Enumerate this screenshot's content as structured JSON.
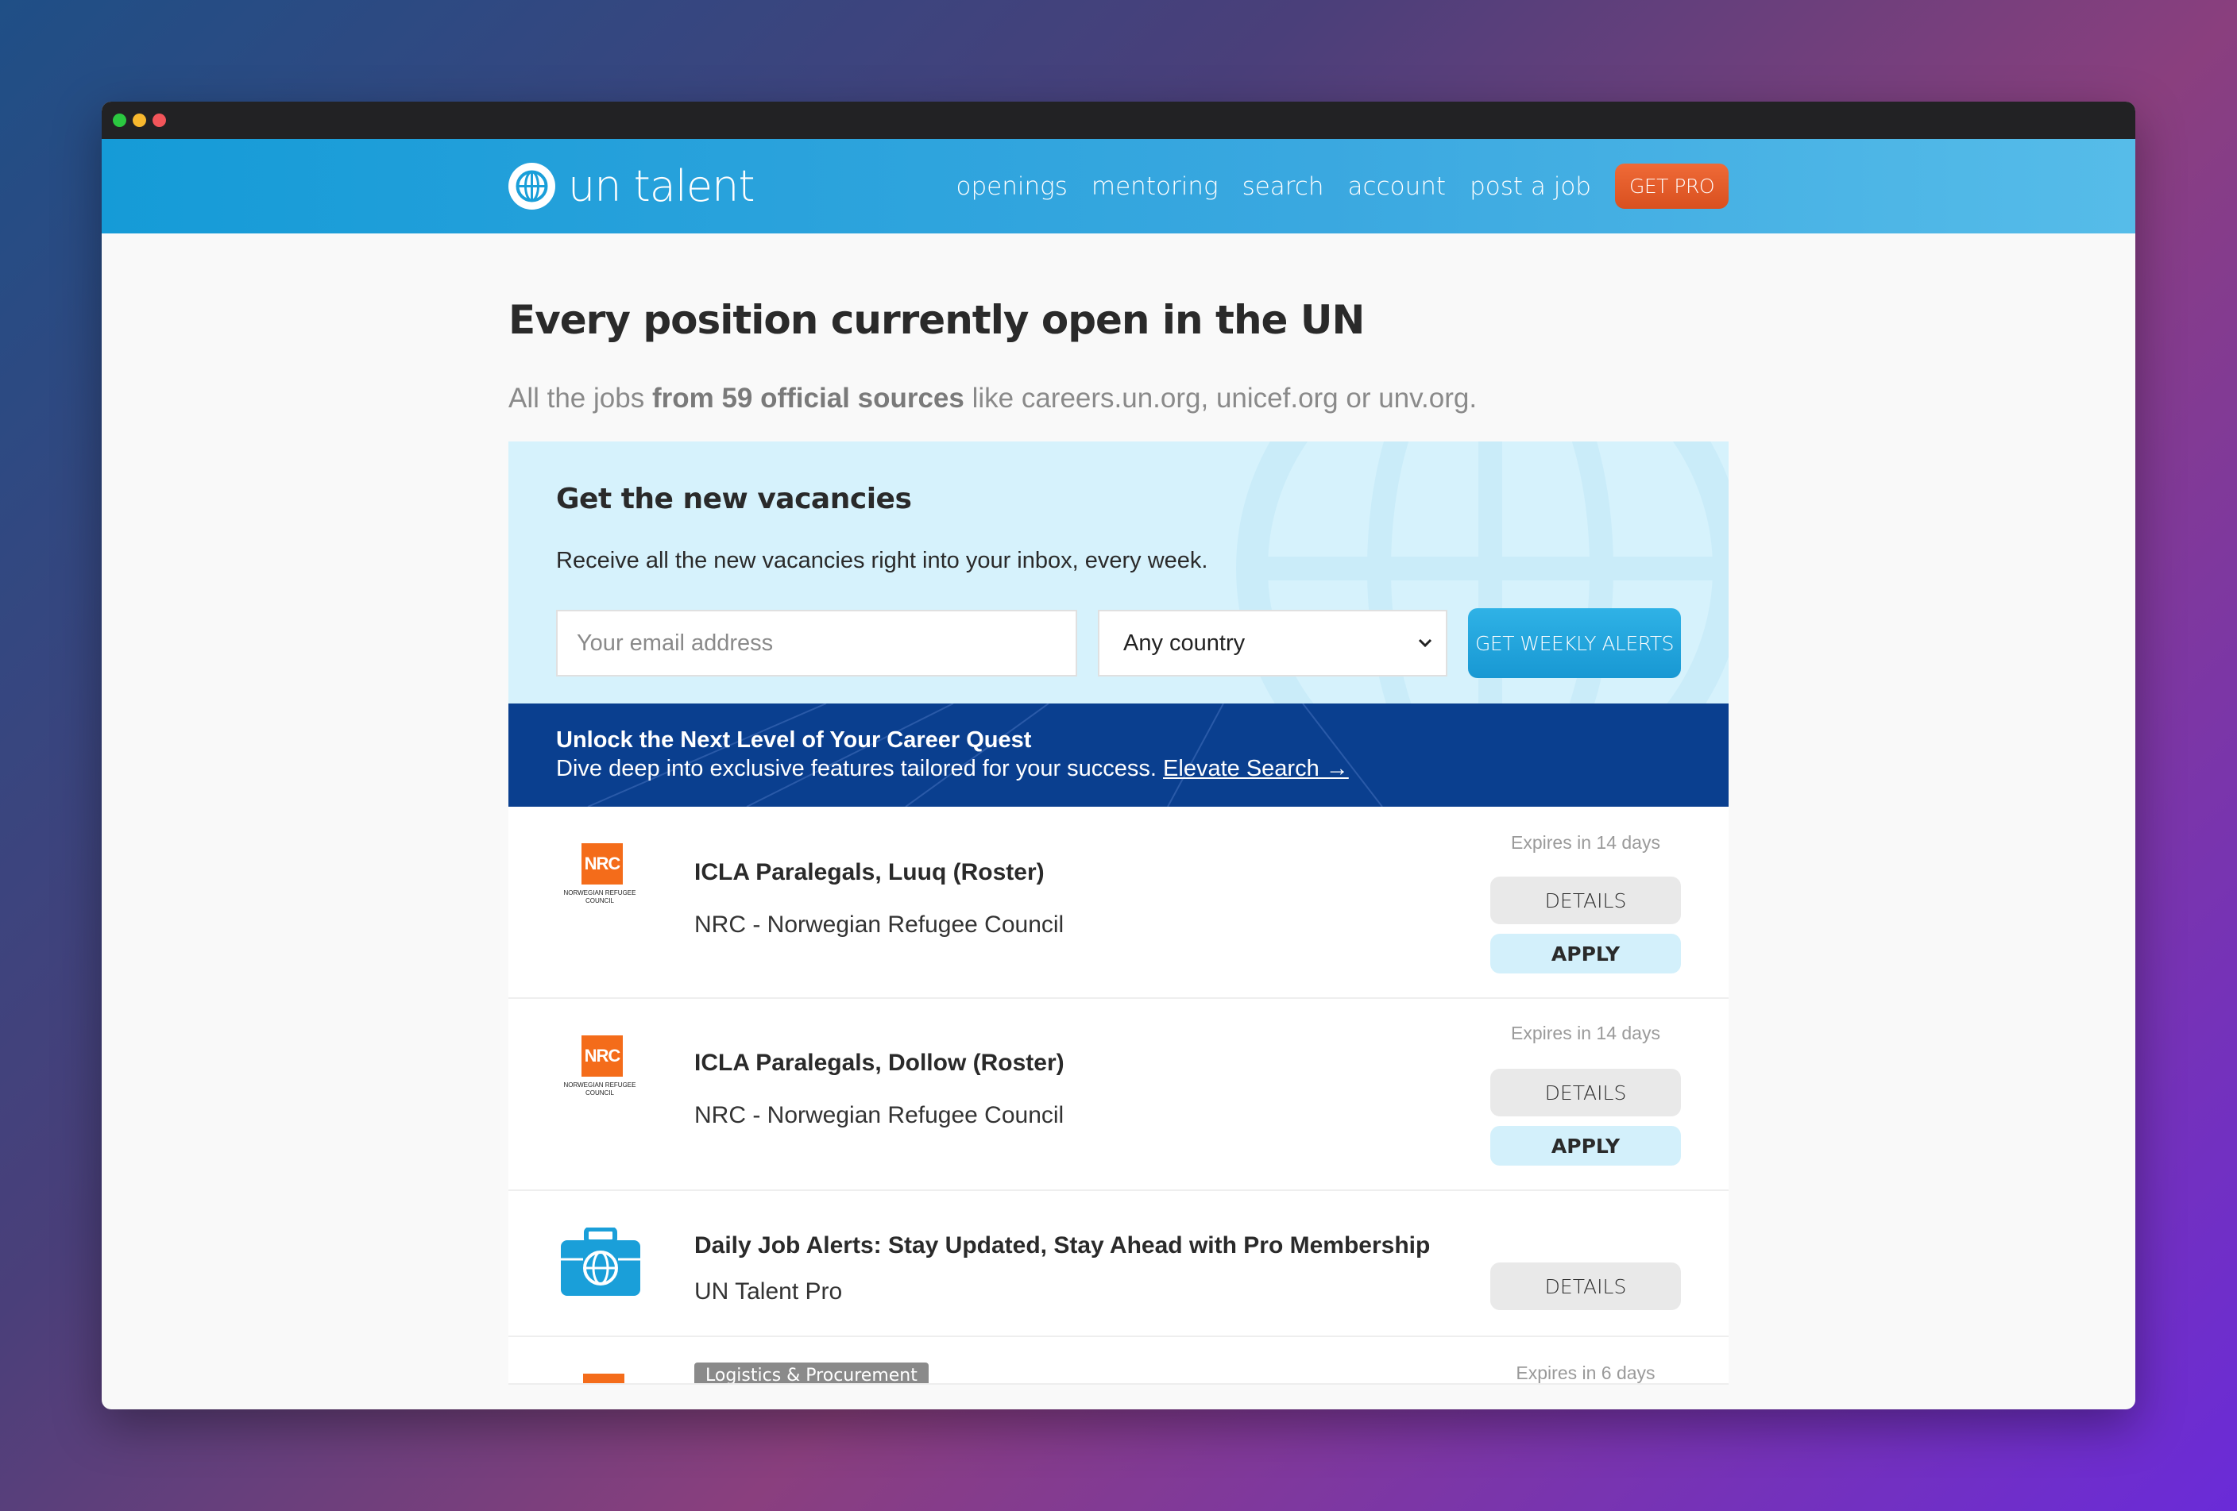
{
  "window": {
    "controls": [
      "close",
      "minimize",
      "maximize"
    ]
  },
  "nav": {
    "logo_text": "un talent",
    "links": [
      "openings",
      "mentoring",
      "search",
      "account",
      "post a job"
    ],
    "cta": "GET PRO"
  },
  "header": {
    "title": "Every position currently open in the UN",
    "subtitle_pre": "All the jobs ",
    "subtitle_bold": "from 59 official sources",
    "subtitle_post": " like careers.un.org, unicef.org or unv.org."
  },
  "alerts": {
    "title": "Get the new vacancies",
    "description": "Receive all the new vacancies right into your inbox, every week.",
    "email_placeholder": "Your email address",
    "country_selected": "Any country",
    "button": "GET WEEKLY ALERTS"
  },
  "promo": {
    "title": "Unlock the Next Level of Your Career Quest",
    "text": "Dive deep into exclusive features tailored for your success. ",
    "link": "Elevate Search →"
  },
  "jobs": [
    {
      "title": "ICLA Paralegals, Luuq (Roster)",
      "org": "NRC - Norwegian Refugee Council",
      "logo_text": "NRC",
      "logo_caption": "NORWEGIAN REFUGEE COUNCIL",
      "expires": "Expires in 14 days",
      "details": "DETAILS",
      "apply": "APPLY"
    },
    {
      "title": "ICLA Paralegals, Dollow (Roster)",
      "org": "NRC - Norwegian Refugee Council",
      "logo_text": "NRC",
      "logo_caption": "NORWEGIAN REFUGEE COUNCIL",
      "expires": "Expires in 14 days",
      "details": "DETAILS",
      "apply": "APPLY"
    },
    {
      "title": "Daily Job Alerts: Stay Updated, Stay Ahead with Pro Membership",
      "org": "UN Talent Pro",
      "details": "DETAILS"
    },
    {
      "tag": "Logistics & Procurement",
      "expires": "Expires in 6 days"
    }
  ],
  "colors": {
    "brand_blue": "#159bd7",
    "cta_orange": "#e35a25",
    "promo_navy": "#0a3f8f",
    "nrc_orange": "#f46c1a"
  }
}
